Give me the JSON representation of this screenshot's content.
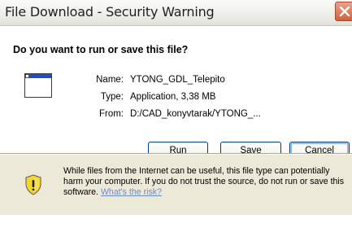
{
  "window": {
    "title": "File Download - Security Warning"
  },
  "dialog": {
    "question": "Do you want to run or save this file?",
    "file": {
      "name_label": "Name:",
      "name_value": "YTONG_GDL_Telepito",
      "type_label": "Type:",
      "type_value": "Application, 3,38 MB",
      "from_label": "From:",
      "from_value": "D:/CAD_konyvtarak/YTONG_..."
    },
    "buttons": {
      "run_key": "R",
      "run_rest": "un",
      "save_key": "S",
      "save_rest": "ave",
      "cancel": "Cancel"
    },
    "warning": {
      "text": "While files from the Internet can be useful, this file type can potentially harm your computer. If you do not trust the source, do not run or save this software. ",
      "link": "What's the risk?"
    }
  },
  "icons": {
    "close": "close-icon",
    "file": "application-file-icon",
    "warning": "warning-shield-icon"
  },
  "colors": {
    "accent_blue": "#003c74",
    "link": "#6b8cc7",
    "close_red": "#d15f3c",
    "shield_yellow": "#f5d431"
  }
}
